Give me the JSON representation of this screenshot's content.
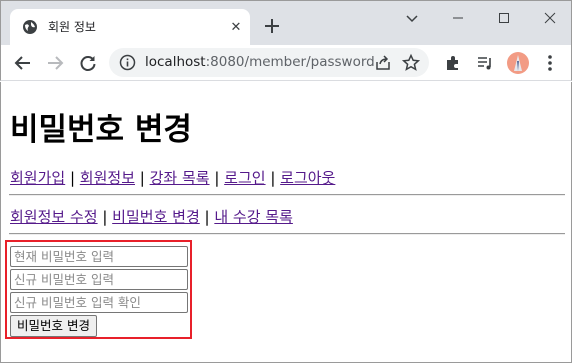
{
  "browser": {
    "tab_title": "회원 정보",
    "tab_close_glyph": "✕",
    "url_host": "localhost",
    "url_rest": ":8080/member/password"
  },
  "page": {
    "title": "비밀번호 변경",
    "nav_primary": [
      "회원가입",
      "회원정보",
      "강좌 목록",
      "로그인",
      "로그아웃"
    ],
    "nav_secondary": [
      "회원정보 수정",
      "비밀번호 변경",
      "내 수강 목록"
    ],
    "separator": " | "
  },
  "form": {
    "current_password_placeholder": "현재 비밀번호 입력",
    "new_password_placeholder": "신규 비밀번호 입력",
    "confirm_password_placeholder": "신규 비밀번호 입력 확인",
    "submit_label": "비밀번호 변경",
    "highlight_color": "#e8202a"
  }
}
